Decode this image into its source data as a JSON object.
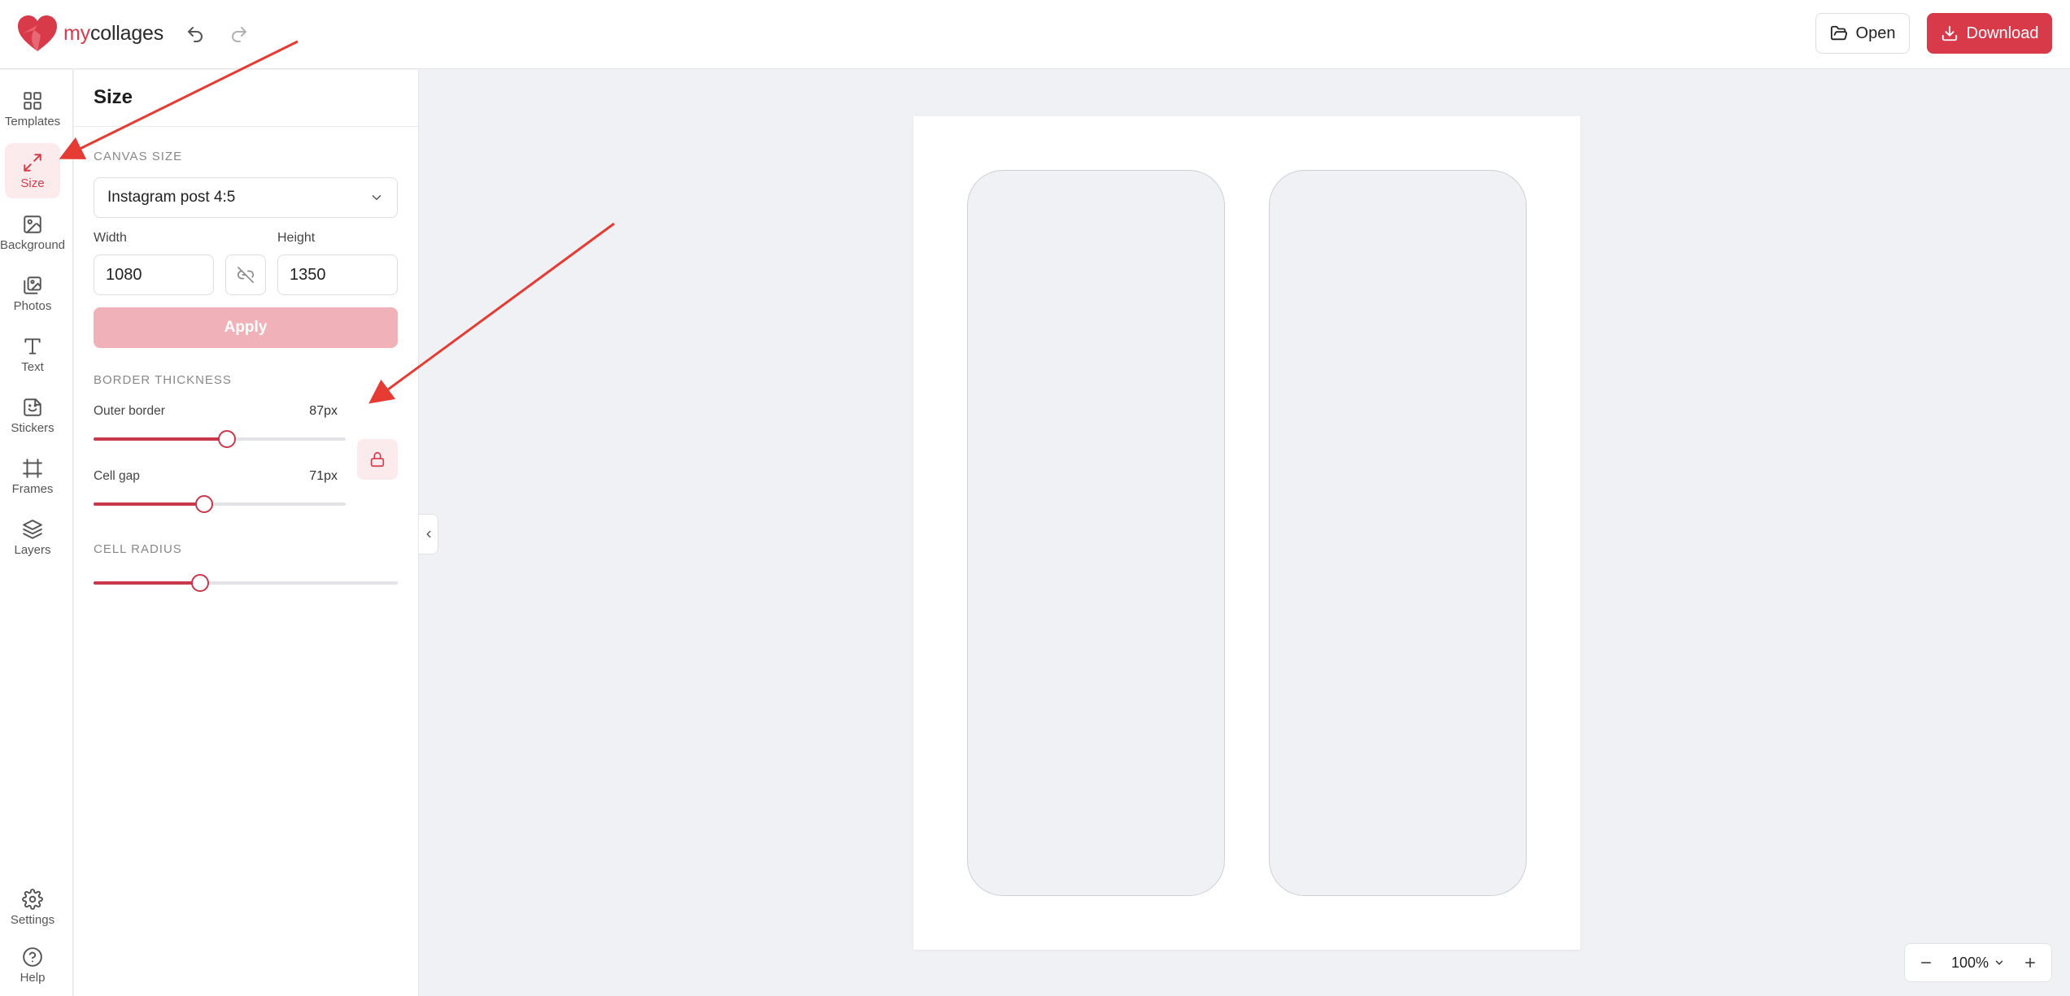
{
  "app": {
    "logo_prefix": "my",
    "logo_suffix": "collages",
    "accent_color": "#d83a4a"
  },
  "header": {
    "undo_icon": "undo-icon",
    "redo_icon": "redo-icon",
    "open_label": "Open",
    "download_label": "Download"
  },
  "rail": {
    "items": [
      {
        "id": "templates",
        "label": "Templates",
        "icon": "grid-icon"
      },
      {
        "id": "size",
        "label": "Size",
        "icon": "resize-icon",
        "active": true
      },
      {
        "id": "background",
        "label": "Background",
        "icon": "image-icon"
      },
      {
        "id": "photos",
        "label": "Photos",
        "icon": "photos-icon"
      },
      {
        "id": "text",
        "label": "Text",
        "icon": "text-icon"
      },
      {
        "id": "stickers",
        "label": "Stickers",
        "icon": "sticker-icon"
      },
      {
        "id": "frames",
        "label": "Frames",
        "icon": "frame-icon"
      },
      {
        "id": "layers",
        "label": "Layers",
        "icon": "layers-icon"
      },
      {
        "id": "settings",
        "label": "Settings",
        "icon": "gear-icon"
      },
      {
        "id": "help",
        "label": "Help",
        "icon": "help-icon"
      }
    ]
  },
  "panel": {
    "title": "Size",
    "canvas_size_label": "CANVAS SIZE",
    "canvas_size_value": "Instagram post 4:5",
    "width_label": "Width",
    "width_value": "1080",
    "height_label": "Height",
    "height_value": "1350",
    "apply_label": "Apply",
    "border_label": "BORDER THICKNESS",
    "outer_border": {
      "label": "Outer border",
      "value_text": "87px",
      "fraction": 0.53
    },
    "cell_gap": {
      "label": "Cell gap",
      "value_text": "71px",
      "fraction": 0.44
    },
    "cell_radius_label": "CELL RADIUS",
    "cell_radius_fraction": 0.35
  },
  "canvas": {
    "cells": 2
  },
  "zoom": {
    "value": "100%"
  }
}
